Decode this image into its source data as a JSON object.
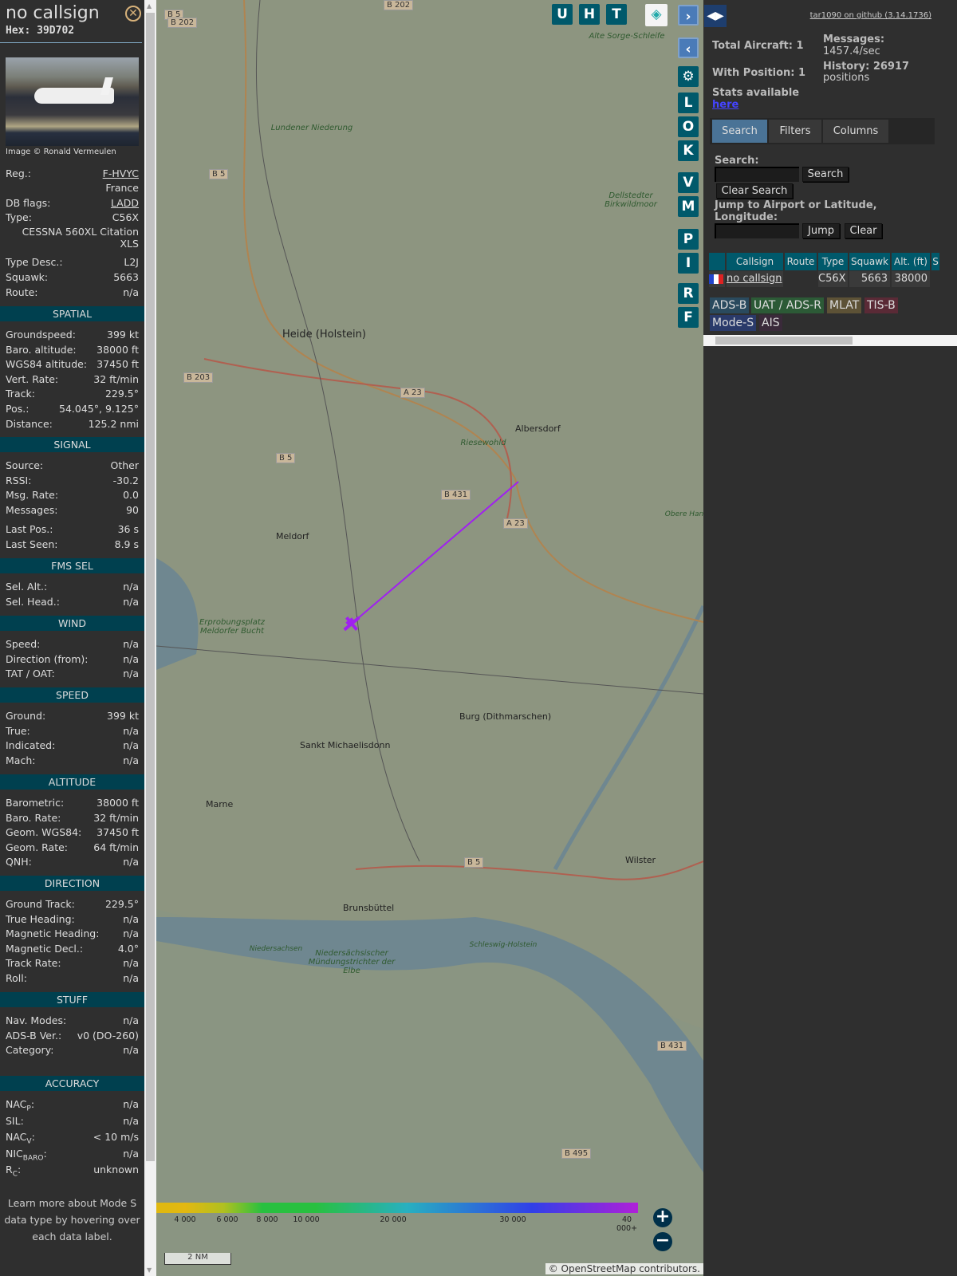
{
  "detail": {
    "title": "no callsign",
    "hex": "Hex: 39D702",
    "photo_credit": "Image © Ronald Vermeulen",
    "info": [
      {
        "label": "Reg.:",
        "value": "F-HVYC",
        "link": true
      },
      {
        "label": "",
        "value": "France"
      },
      {
        "label": "DB flags:",
        "value": "LADD",
        "link": true
      },
      {
        "label": "Type:",
        "value": "C56X"
      },
      {
        "label": "",
        "value": "CESSNA 560XL Citation XLS"
      },
      {
        "label": "Type Desc.:",
        "value": "L2J"
      },
      {
        "label": "Squawk:",
        "value": "5663"
      },
      {
        "label": "Route:",
        "value": "n/a"
      }
    ],
    "sections": [
      {
        "title": "SPATIAL",
        "rows": [
          [
            "Groundspeed:",
            "",
            "399 kt"
          ],
          [
            "Baro. altitude:",
            "",
            "38000 ft"
          ],
          [
            "WGS84 altitude:",
            "",
            "37450 ft"
          ],
          [
            "Vert. Rate:",
            "",
            "32 ft/min"
          ],
          [
            "Track:",
            "",
            "229.5°"
          ],
          [
            "Pos.:",
            "",
            "54.045°, 9.125°"
          ],
          [
            "Distance:",
            "",
            "125.2 nmi"
          ]
        ]
      },
      {
        "title": "SIGNAL",
        "rows": [
          [
            "Source:",
            "",
            "Other"
          ],
          [
            "RSSI:",
            "",
            "-30.2"
          ],
          [
            "Msg. Rate:",
            "",
            "0.0"
          ],
          [
            "Messages:",
            "",
            "90"
          ],
          [
            "Last Pos.:",
            "",
            "36 s"
          ],
          [
            "Last Seen:",
            "",
            "8.9 s"
          ]
        ]
      },
      {
        "title": "FMS SEL",
        "rows": [
          [
            "Sel. Alt.:",
            "",
            "n/a"
          ],
          [
            "Sel. Head.:",
            "",
            "n/a"
          ]
        ]
      },
      {
        "title": "WIND",
        "rows": [
          [
            "Speed:",
            "",
            "n/a"
          ],
          [
            "Direction (from):",
            "",
            "n/a"
          ],
          [
            "TAT / OAT:",
            "",
            "n/a"
          ]
        ]
      },
      {
        "title": "SPEED",
        "rows": [
          [
            "Ground:",
            "",
            "399 kt"
          ],
          [
            "True:",
            "",
            "n/a"
          ],
          [
            "Indicated:",
            "",
            "n/a"
          ],
          [
            "Mach:",
            "",
            "n/a"
          ]
        ]
      },
      {
        "title": "ALTITUDE",
        "rows": [
          [
            "Barometric:",
            "",
            "38000 ft"
          ],
          [
            "Baro. Rate:",
            "",
            "32 ft/min"
          ],
          [
            "Geom. WGS84:",
            "",
            "37450 ft"
          ],
          [
            "Geom. Rate:",
            "",
            "64 ft/min"
          ],
          [
            "QNH:",
            "",
            "n/a"
          ]
        ]
      },
      {
        "title": "DIRECTION",
        "rows": [
          [
            "Ground Track:",
            "",
            "229.5°"
          ],
          [
            "True Heading:",
            "",
            "n/a"
          ],
          [
            "Magnetic Heading:",
            "",
            "n/a"
          ],
          [
            "Magnetic Decl.:",
            "",
            "4.0°"
          ],
          [
            "Track Rate:",
            "",
            "n/a"
          ],
          [
            "Roll:",
            "",
            "n/a"
          ]
        ]
      },
      {
        "title": "STUFF",
        "rows": [
          [
            "Nav. Modes:",
            "",
            "n/a"
          ],
          [
            "ADS-B Ver.:",
            "",
            "v0 (DO-260)"
          ],
          [
            "Category:",
            "",
            "n/a"
          ]
        ]
      },
      {
        "title": "ACCURACY",
        "rows": [
          [
            "NAC",
            "P",
            "n/a"
          ],
          [
            "SIL:",
            "",
            "n/a"
          ],
          [
            "NAC",
            "V",
            "< 10 m/s"
          ],
          [
            "NIC",
            "BARO",
            "n/a"
          ],
          [
            "R",
            "C",
            "unknown"
          ]
        ]
      }
    ],
    "footer": "Learn more about Mode S data type by hovering over each data label."
  },
  "map": {
    "buttons_top": [
      "U",
      "H",
      "T"
    ],
    "buttons_side": [
      "L",
      "O",
      "K",
      "V",
      "M",
      "P",
      "I",
      "R",
      "F"
    ],
    "labels": [
      "Heide (Holstein)",
      "Albersdorf",
      "Meldorf",
      "Burg (Dithmarschen)",
      "Sankt Michaelisdonn",
      "Marne",
      "Wilster",
      "Brunsbüttel",
      "Lundener Niederung",
      "Alte Sorge-Schleife",
      "Dellstedter Birkwildmoor",
      "Riesewohld",
      "Erprobungsplatz Meldorfer Bucht",
      "Niedersächsischer Mündungstrichter der Elbe",
      "Schleswig-Holstein",
      "Niedersachsen",
      "Obere Haneraue"
    ],
    "road_labels": [
      "B 5",
      "B 202",
      "B 5",
      "B 203",
      "A 23",
      "B 5",
      "B 431",
      "A 23",
      "B 5",
      "B 431",
      "B 495",
      "B 202"
    ],
    "altitude_scale": [
      "4 000",
      "6 000",
      "8 000",
      "10 000",
      "20 000",
      "30 000",
      "40 000+"
    ],
    "scale_bar": "2 NM",
    "attribution": "© OpenStreetMap contributors.",
    "track_color": "#a020f0"
  },
  "right": {
    "github": "tar1090 on github (3.14.1736)",
    "total_aircraft": "Total Aircraft: 1",
    "with_position": "With Position: 1",
    "messages_label": "Messages:",
    "messages_value": "1457.4/sec",
    "history_label": "History: 26917",
    "history_value": "positions",
    "stats": "Stats available",
    "stats_link": "here",
    "tabs": [
      "Search",
      "Filters",
      "Columns"
    ],
    "search_label": "Search:",
    "search_btn": "Search",
    "clear_search": "Clear Search",
    "jump_label": "Jump to Airport or Latitude, Longitude:",
    "jump_btn": "Jump",
    "clear_btn": "Clear",
    "columns": [
      "Callsign",
      "Route",
      "Type",
      "Squawk",
      "Alt. (ft)",
      "S"
    ],
    "row": {
      "callsign": "no callsign",
      "route": "",
      "type": "C56X",
      "squawk": "5663",
      "alt": "38000"
    },
    "badges": [
      {
        "t": "ADS-B",
        "c": "#2a4a5e"
      },
      {
        "t": "UAT / ADS-R",
        "c": "#2c5a36"
      },
      {
        "t": "MLAT",
        "c": "#5d5236"
      },
      {
        "t": "TIS-B",
        "c": "#5a2a36"
      },
      {
        "t": "Mode-S",
        "c": "#2a3a6a"
      },
      {
        "t": "AIS",
        "c": "#3a2a3a"
      }
    ]
  }
}
